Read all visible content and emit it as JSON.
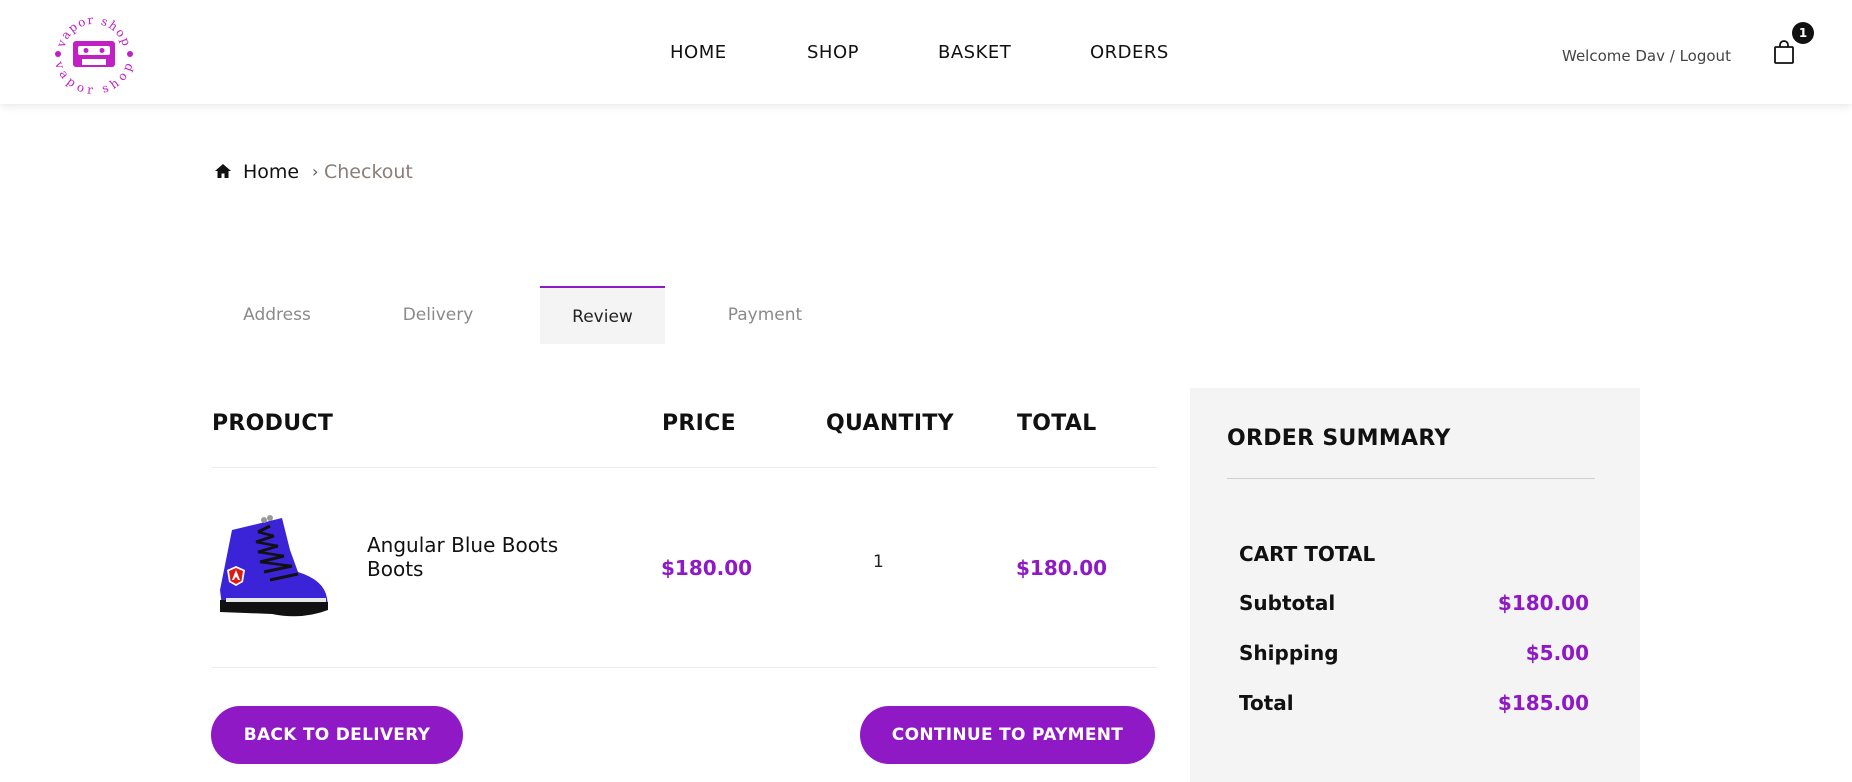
{
  "brand": {
    "logo_text_top": "vapor shop",
    "logo_text_bottom": "vapor shop",
    "accent_color": "#8e19c5"
  },
  "nav": {
    "items": [
      {
        "label": "HOME"
      },
      {
        "label": "SHOP"
      },
      {
        "label": "BASKET"
      },
      {
        "label": "ORDERS"
      }
    ],
    "welcome": "Welcome Dav / Logout",
    "cart_icon": "shopping-bag-icon",
    "cart_count": "1"
  },
  "breadcrumb": {
    "home_icon": "home-icon",
    "home": "Home",
    "separator": "›",
    "current": "Checkout"
  },
  "steps": {
    "tabs": [
      {
        "label": "Address"
      },
      {
        "label": "Delivery"
      },
      {
        "label": "Review"
      },
      {
        "label": "Payment"
      }
    ],
    "active": "Review"
  },
  "table": {
    "headers": {
      "product": "PRODUCT",
      "price": "PRICE",
      "quantity": "QUANTITY",
      "total": "TOTAL"
    },
    "rows": [
      {
        "name": "Angular Blue Boots Boots",
        "price": "$180.00",
        "quantity": "1",
        "total": "$180.00",
        "image_icon": "blue-boot-image"
      }
    ]
  },
  "actions": {
    "back": "BACK TO DELIVERY",
    "continue": "CONTINUE TO PAYMENT"
  },
  "summary": {
    "title": "ORDER SUMMARY",
    "cart_total_label": "CART TOTAL",
    "subtotal_label": "Subtotal",
    "subtotal": "$180.00",
    "shipping_label": "Shipping",
    "shipping": "$5.00",
    "total_label": "Total",
    "total": "$185.00"
  }
}
